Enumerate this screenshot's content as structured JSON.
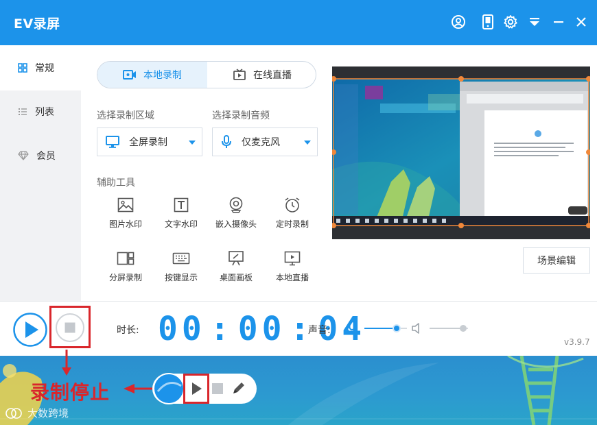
{
  "app": {
    "title": "EV录屏"
  },
  "titlebar": {
    "icons": [
      "user-icon",
      "phone-icon",
      "gear-icon",
      "menu-down-icon",
      "minimize-icon",
      "close-icon"
    ]
  },
  "sidebar": {
    "items": [
      {
        "label": "常规",
        "icon": "grid-icon",
        "active": true
      },
      {
        "label": "列表",
        "icon": "list-icon",
        "active": false
      },
      {
        "label": "会员",
        "icon": "diamond-icon",
        "active": false
      }
    ]
  },
  "mode_tabs": {
    "local": "本地录制",
    "live": "在线直播",
    "active": "local"
  },
  "record_area": {
    "label": "选择录制区域",
    "value": "全屏录制"
  },
  "record_audio": {
    "label": "选择录制音频",
    "value": "仅麦克风"
  },
  "tools": {
    "label": "辅助工具",
    "items": [
      {
        "label": "图片水印",
        "icon": "image-icon"
      },
      {
        "label": "文字水印",
        "icon": "text-icon"
      },
      {
        "label": "嵌入摄像头",
        "icon": "webcam-icon"
      },
      {
        "label": "定时录制",
        "icon": "alarm-clock-icon"
      },
      {
        "label": "分屏录制",
        "icon": "split-screen-icon"
      },
      {
        "label": "按键显示",
        "icon": "keyboard-icon"
      },
      {
        "label": "桌面画板",
        "icon": "easel-icon"
      },
      {
        "label": "本地直播",
        "icon": "monitor-play-icon"
      }
    ]
  },
  "scene_button": "场景编辑",
  "controls": {
    "duration_label": "时长:",
    "timer": {
      "h": "00",
      "m": "00",
      "s": "04"
    },
    "volume_label": "声音:",
    "mic_level": 0.75,
    "speaker_level": 0.88
  },
  "version": "v3.9.7",
  "annotation": {
    "text": "录制停止"
  },
  "watermark": {
    "text": "大数跨境"
  },
  "colors": {
    "accent": "#1c93ea",
    "annotation_red": "#d9262b",
    "sidebar_bg": "#f1f2f4"
  }
}
